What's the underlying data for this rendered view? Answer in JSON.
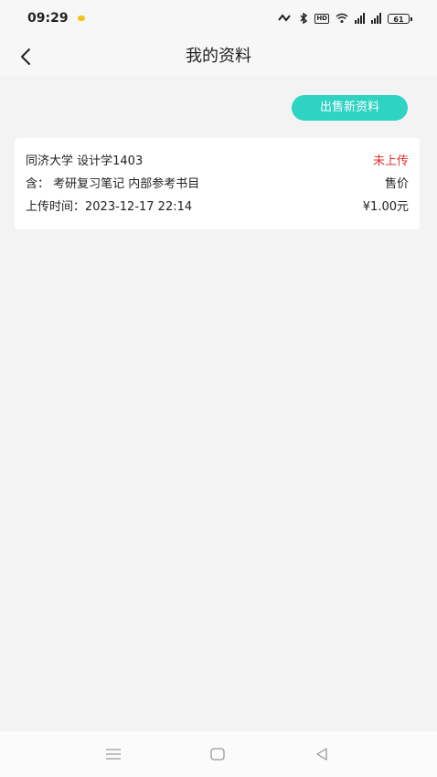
{
  "status_bar": {
    "time": "09:29",
    "battery": "61",
    "hd_label": "HD"
  },
  "header": {
    "title": "我的资料"
  },
  "actions": {
    "sell_new_label": "出售新资料"
  },
  "listing": {
    "name": "同济大学 设计学1403",
    "status": "未上传",
    "contents": "含： 考研复习笔记 内部参考书目",
    "price_label": "售价",
    "upload_time": "上传时间：2023-12-17 22:14",
    "price": "¥1.00元"
  },
  "colors": {
    "accent": "#2fd3c2",
    "status_red": "#e0322c"
  },
  "icons": {
    "back": "chevron-left",
    "menu": "menu",
    "home": "home",
    "back_system": "triangle-left"
  }
}
